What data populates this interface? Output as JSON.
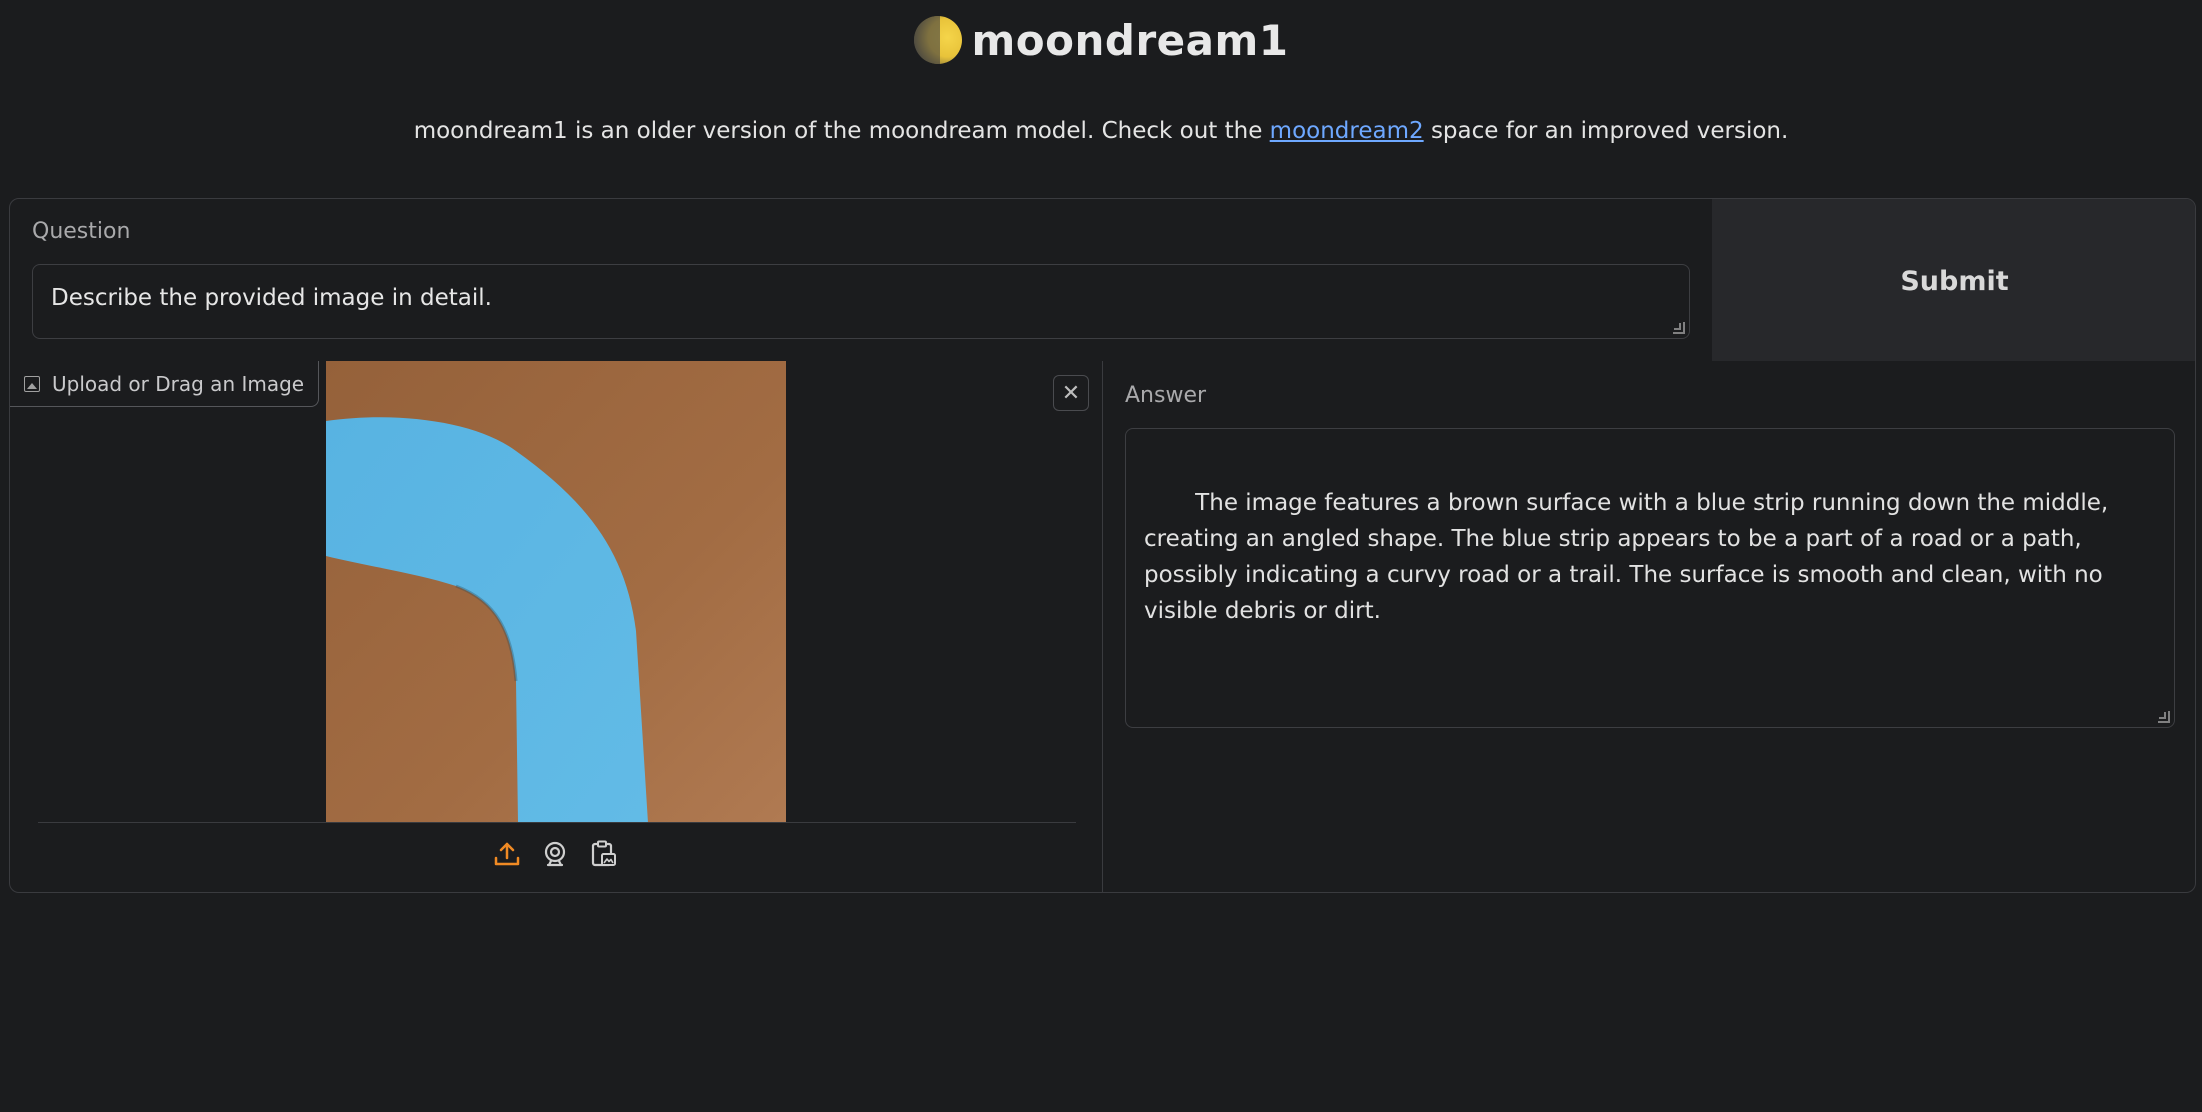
{
  "header": {
    "title": "moondream1",
    "icon": "moon-emoji"
  },
  "subtitle": {
    "text_before": "moondream1 is an older version of the moondream model. Check out the ",
    "link_text": "moondream2",
    "text_after": " space for an improved version."
  },
  "question": {
    "label": "Question",
    "value": "Describe the provided image in detail."
  },
  "submit": {
    "label": "Submit"
  },
  "image_input": {
    "label": "Upload or Drag an Image",
    "close_icon": "close-icon",
    "sources": [
      "upload-icon",
      "webcam-icon",
      "clipboard-icon"
    ]
  },
  "answer": {
    "label": "Answer",
    "value": " The image features a brown surface with a blue strip running down the middle, creating an angled shape. The blue strip appears to be a part of a road or a path, possibly indicating a curvy road or a trail. The surface is smooth and clean, with no visible debris or dirt."
  },
  "colors": {
    "background": "#1b1c1e",
    "link": "#6ea8ff",
    "accent_upload": "#f08a24",
    "photo_brown": "#a0693f",
    "photo_blue": "#5bb6e3"
  }
}
